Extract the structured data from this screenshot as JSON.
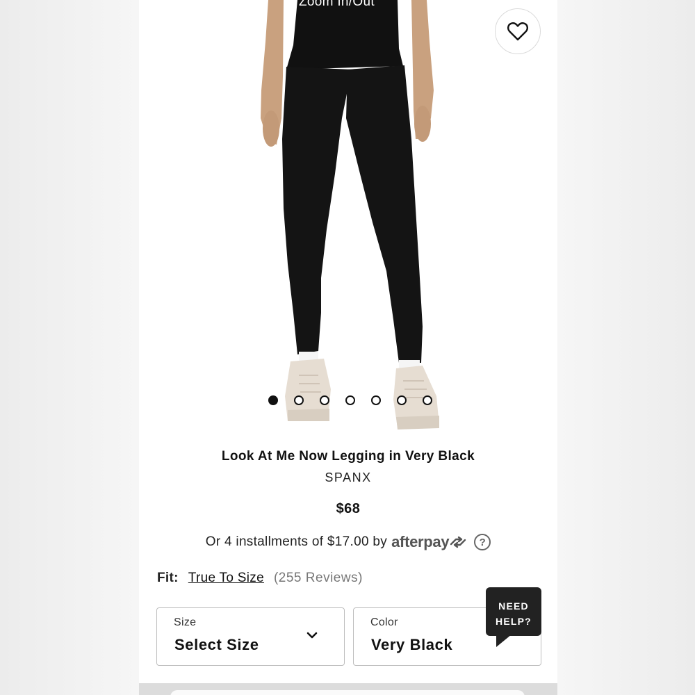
{
  "photo": {
    "zoom_label": "Zoom In/Out",
    "carousel_dots": 7,
    "active_dot": 0
  },
  "product": {
    "title": "Look At Me Now Legging in Very Black",
    "brand": "SPANX",
    "price": "$68"
  },
  "installments": {
    "text": "Or 4 installments of $17.00 by",
    "provider": "afterpay",
    "help_glyph": "?"
  },
  "fit": {
    "label": "Fit:",
    "value": "True To Size",
    "reviews": "(255 Reviews)"
  },
  "size_select": {
    "label": "Size",
    "value": "Select Size"
  },
  "color_select": {
    "label": "Color",
    "value": "Very Black"
  },
  "help_chat": {
    "line1": "NEED",
    "line2": "HELP?"
  },
  "colors": {
    "legging": "#111111",
    "sneaker": "#e6ddd2",
    "skin": "#caa07c"
  }
}
